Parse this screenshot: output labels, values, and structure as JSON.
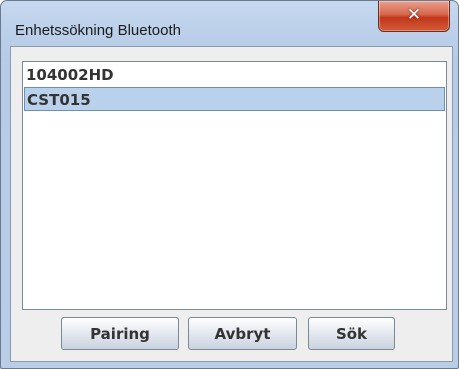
{
  "window": {
    "title": "Enhetssökning Bluetooth",
    "close_icon_glyph": "✕"
  },
  "devices": {
    "items": [
      {
        "label": "104002HD",
        "selected": false
      },
      {
        "label": "CST015",
        "selected": true
      }
    ]
  },
  "buttons": {
    "pairing_label": "Pairing",
    "cancel_label": "Avbryt",
    "search_label": "Sök"
  },
  "colors": {
    "selection_bg": "#b9d1ea",
    "close_button": "#c1371b",
    "frame": "#b9cde7"
  }
}
